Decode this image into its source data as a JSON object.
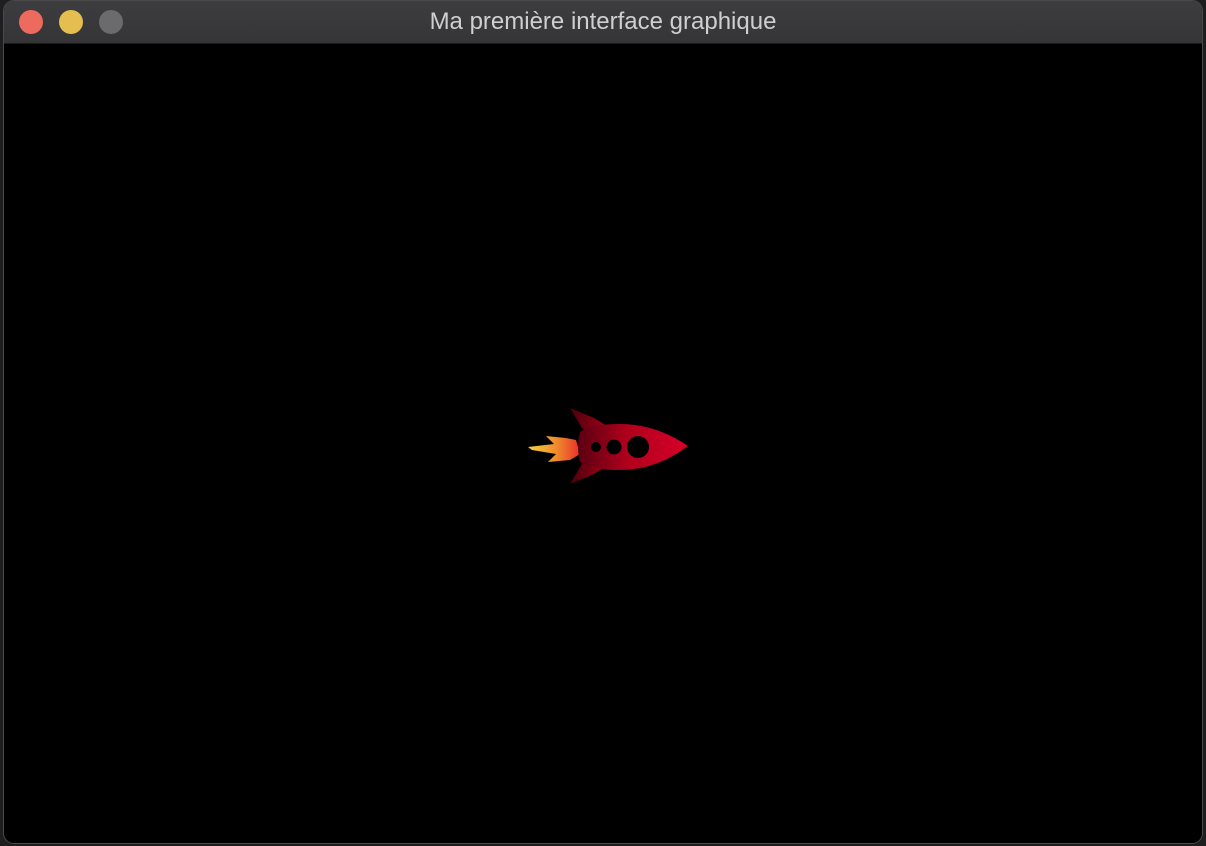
{
  "window": {
    "title": "Ma première interface graphique",
    "background_color": "#000000",
    "controls": {
      "close_color": "#ed6a5e",
      "minimize_color": "#e4bf50",
      "zoom_color": "#6b6b6d"
    }
  },
  "canvas": {
    "sprite": "rocket-icon",
    "rocket_body_color": "#c4001e",
    "flame_colors": [
      "#f5d43a",
      "#f08a2c",
      "#e8302a"
    ]
  }
}
